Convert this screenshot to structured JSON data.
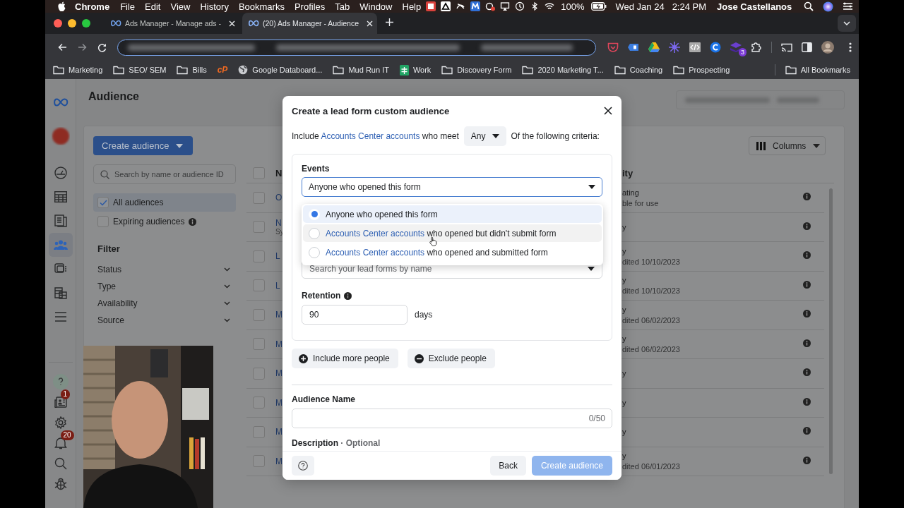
{
  "menubar": {
    "app": "Chrome",
    "menus": [
      "File",
      "Edit",
      "View",
      "History",
      "Bookmarks",
      "Profiles",
      "Tab",
      "Window",
      "Help"
    ],
    "battery": "100%",
    "date": "Wed Jan 24",
    "time": "2:24 PM",
    "user": "Jose Castellanos"
  },
  "browser": {
    "tabs": [
      {
        "title": "Ads Manager - Manage ads -",
        "selected": false
      },
      {
        "title": "(20) Ads Manager - Audience",
        "selected": true
      }
    ],
    "extension_badge": "3",
    "bookmarks": [
      {
        "kind": "folder",
        "label": "Marketing"
      },
      {
        "kind": "folder",
        "label": "SEO/ SEM"
      },
      {
        "kind": "folder",
        "label": "Bills"
      },
      {
        "kind": "logo",
        "label": "cP"
      },
      {
        "kind": "globe",
        "label": "Google Databoard..."
      },
      {
        "kind": "folder",
        "label": "Mud Run IT"
      },
      {
        "kind": "sheet",
        "label": "Work"
      },
      {
        "kind": "folder",
        "label": "Discovery Form"
      },
      {
        "kind": "folder",
        "label": "2020 Marketing T..."
      },
      {
        "kind": "folder",
        "label": "Coaching"
      },
      {
        "kind": "folder",
        "label": "Prospecting"
      }
    ],
    "all_bookmarks": "All Bookmarks"
  },
  "page": {
    "title": "Audience",
    "rail": [
      {
        "kind": "gauge",
        "selected": false
      },
      {
        "kind": "table",
        "selected": false
      },
      {
        "kind": "pages",
        "selected": false
      },
      {
        "kind": "people",
        "selected": true
      },
      {
        "kind": "stack",
        "selected": false
      },
      {
        "kind": "coins",
        "selected": false
      },
      {
        "kind": "menu",
        "selected": false
      }
    ],
    "rail_bottom": [
      {
        "kind": "help"
      },
      {
        "kind": "news",
        "badge": "1"
      },
      {
        "kind": "gear"
      },
      {
        "kind": "bell",
        "badge": "20"
      },
      {
        "kind": "search"
      },
      {
        "kind": "bug"
      }
    ],
    "create_button": "Create audience",
    "search": {
      "placeholder": "Search by name or audience ID"
    },
    "views": [
      {
        "label": "All audiences",
        "checked": true,
        "info": false
      },
      {
        "label": "Expiring audiences",
        "checked": false,
        "info": true
      }
    ],
    "filter": {
      "title": "Filter",
      "items": [
        "Status",
        "Type",
        "Availability",
        "Source"
      ]
    },
    "columns_button": "Columns",
    "table": {
      "columns": [
        "N",
        "ity"
      ],
      "select_all_checked": false,
      "rows": [
        {
          "checked": false,
          "name": "O",
          "availability": "ating",
          "note": "ble for use"
        },
        {
          "checked": false,
          "name": "N",
          "sub": "Sy",
          "availability": "y"
        },
        {
          "checked": false,
          "name": "L",
          "availability": "y",
          "note": "dited 10/10/2023"
        },
        {
          "checked": false,
          "name": "L",
          "availability": "y",
          "note": "dited 10/10/2023"
        },
        {
          "checked": false,
          "name": "M",
          "availability": "y",
          "note": "dited 06/02/2023"
        },
        {
          "checked": false,
          "name": "M",
          "availability": "y",
          "note": "dited 06/02/2023"
        },
        {
          "checked": false,
          "name": "M",
          "availability": "y"
        },
        {
          "checked": false,
          "name": "M",
          "availability": "y"
        },
        {
          "checked": false,
          "name": "M",
          "availability": "y"
        },
        {
          "checked": false,
          "name": "M",
          "availability": "y",
          "note": "dited 06/01/2023"
        }
      ]
    }
  },
  "dialog": {
    "title": "Create a lead form custom audience",
    "include": {
      "before": "Include",
      "link": "Accounts Center accounts",
      "after": "who meet",
      "match": "Any",
      "tail": "Of the following criteria:"
    },
    "events": {
      "label": "Events",
      "value": "Anyone who opened this form",
      "options": [
        {
          "text": "Anyone who opened this form",
          "selected": true,
          "hovered": false
        },
        {
          "link": "Accounts Center accounts",
          "text": "who opened but didn't submit form",
          "selected": false,
          "hovered": true
        },
        {
          "link": "Accounts Center accounts",
          "text": "who opened and submitted form",
          "selected": false,
          "hovered": false
        }
      ]
    },
    "form_search": {
      "placeholder": "Search your lead forms by name"
    },
    "retention": {
      "label": "Retention",
      "value": "90",
      "unit": "days"
    },
    "include_button": "Include more people",
    "exclude_button": "Exclude people",
    "name": {
      "label": "Audience Name",
      "counter": "0/50"
    },
    "description": {
      "label": "Description",
      "optional": "· Optional"
    },
    "back_button": "Back",
    "create_button": {
      "label": "Create audience",
      "disabled": true
    }
  }
}
